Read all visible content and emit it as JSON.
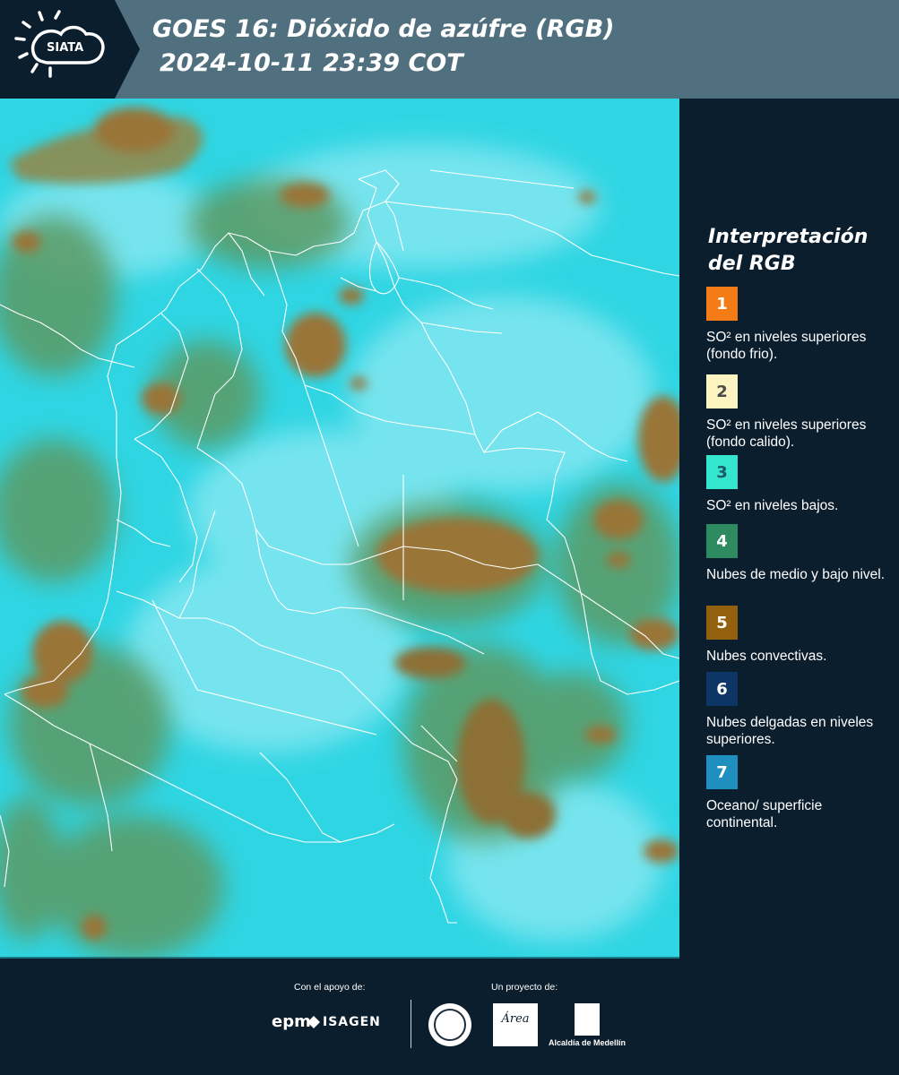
{
  "header": {
    "logo_text": "SIATA",
    "title_line1": "GOES 16: Dióxido de azúfre (RGB)",
    "title_line2": "2024-10-11 23:39 COT"
  },
  "legend": {
    "title": "Interpretación del RGB",
    "items": [
      {
        "number": "1",
        "color": "#f47c17",
        "text_color": "#ffffff",
        "text": "SO² en niveles superiores (fondo frio)."
      },
      {
        "number": "2",
        "color": "#fbf3c0",
        "text_color": "#4a4a4a",
        "text": "SO² en niveles superiores (fondo calido)."
      },
      {
        "number": "3",
        "color": "#35e6cf",
        "text_color": "#1d5a66",
        "text": "SO² en niveles bajos."
      },
      {
        "number": "4",
        "color": "#2e8a61",
        "text_color": "#ffffff",
        "text": "Nubes de medio y bajo nivel."
      },
      {
        "number": "5",
        "color": "#93600e",
        "text_color": "#ffffff",
        "text": "Nubes convectivas."
      },
      {
        "number": "6",
        "color": "#0d3566",
        "text_color": "#ffffff",
        "text": "Nubes delgadas en niveles superiores."
      },
      {
        "number": "7",
        "color": "#1f8fbf",
        "text_color": "#ffffff",
        "text": "Oceano/ superficie continental."
      }
    ]
  },
  "map": {
    "colors": {
      "background": "#2fd5e3",
      "haze": "#8ee9f2",
      "green_cloud": "#5c9a63",
      "convective": "#9a7537",
      "borders": "#ffffff"
    }
  },
  "footer": {
    "support_label": "Con el apoyo de:",
    "project_label": "Un proyecto de:",
    "logos": {
      "epm": "epm",
      "isagen": "ISAGEN",
      "area_metropolitana": "Área",
      "alcaldia": "Alcaldía de Medellín"
    }
  }
}
